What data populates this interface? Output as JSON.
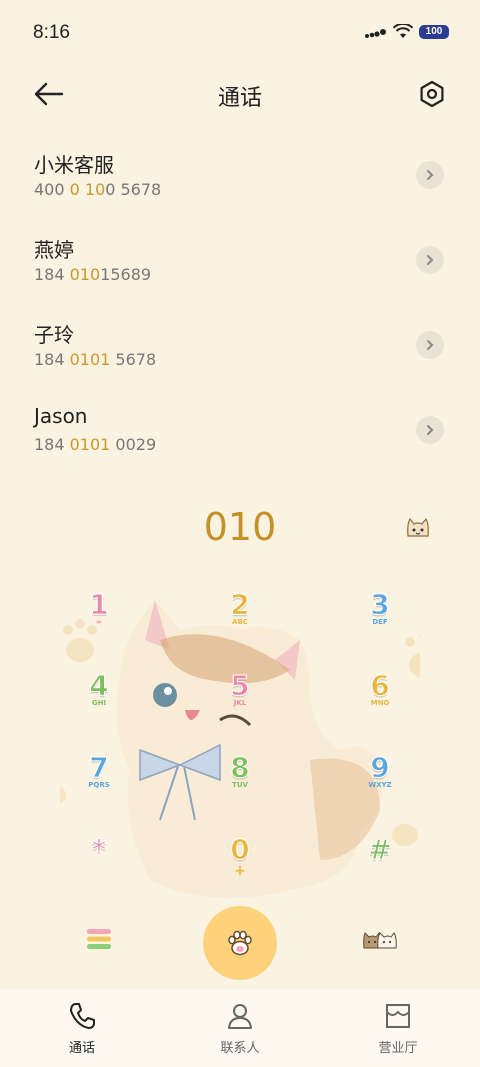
{
  "status": {
    "time": "8:16",
    "battery": "100"
  },
  "header": {
    "title": "通话"
  },
  "contacts": [
    {
      "name": "小米客服",
      "num_pre": "400 ",
      "num_hl": "0 10",
      "num_post": "0 5678"
    },
    {
      "name": "燕婷",
      "num_pre": "184 ",
      "num_hl": "010",
      "num_post": "15689"
    },
    {
      "name": "子玲",
      "num_pre": "184 ",
      "num_hl": "0101",
      "num_post": " 5678"
    },
    {
      "name": "Jason",
      "num_pre": "184 ",
      "num_hl": "0101",
      "num_post": " 0029"
    }
  ],
  "dialed": "010",
  "keypad": [
    {
      "digit": "1",
      "letters": "∞",
      "color": "#e889a6"
    },
    {
      "digit": "2",
      "letters": "ABC",
      "color": "#e7b63f"
    },
    {
      "digit": "3",
      "letters": "DEF",
      "color": "#5aa6dc"
    },
    {
      "digit": "4",
      "letters": "GHI",
      "color": "#7cbf5c"
    },
    {
      "digit": "5",
      "letters": "JKL",
      "color": "#e889a6"
    },
    {
      "digit": "6",
      "letters": "MNO",
      "color": "#e7b63f"
    },
    {
      "digit": "7",
      "letters": "PQRS",
      "color": "#5aa6dc"
    },
    {
      "digit": "8",
      "letters": "TUV",
      "color": "#7cbf5c"
    },
    {
      "digit": "9",
      "letters": "WXYZ",
      "color": "#5aa6dc"
    },
    {
      "digit": "*",
      "letters": "",
      "color": "#e889a6"
    },
    {
      "digit": "0",
      "letters": "+",
      "color": "#e7b63f"
    },
    {
      "digit": "#",
      "letters": "",
      "color": "#7cbf5c"
    }
  ],
  "nav": [
    {
      "label": "通话",
      "active": true
    },
    {
      "label": "联系人",
      "active": false
    },
    {
      "label": "营业厅",
      "active": false
    }
  ],
  "colors": {
    "accent": "#c49128",
    "background": "#fbf3e2",
    "call_button": "#fdd27a"
  }
}
